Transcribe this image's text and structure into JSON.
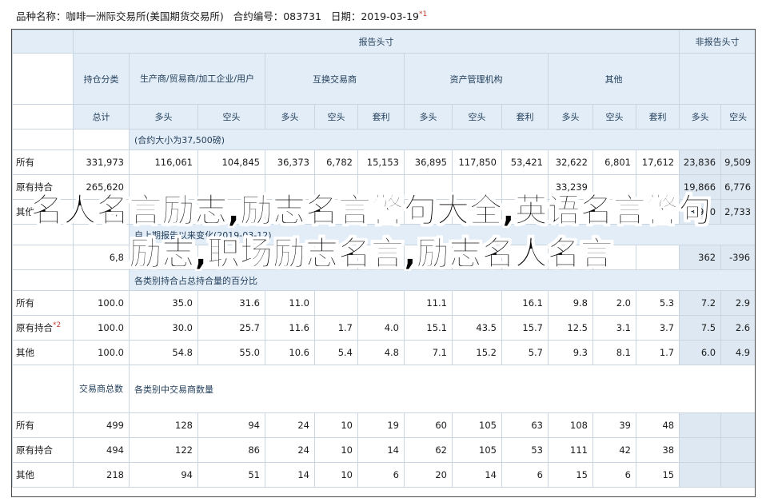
{
  "header": {
    "market": "品种名称：咖啡一洲际交易所(美国期货交易所)",
    "code": "合约编号：083731",
    "date": "日期：2019-03-19",
    "date_note": "*1"
  },
  "table": {
    "group_reportable": "报告头寸",
    "group_nonreportable": "非报告头寸",
    "col_category": "持仓分类",
    "col_producer": "生产商/贸易商/加工企业/用户",
    "col_swap": "互换交易商",
    "col_money": "资产管理机构",
    "col_other": "其他",
    "col_total": "总计",
    "long": "多头",
    "short": "空头",
    "spread": "套利",
    "section1": "(合约大小为37,500磅)",
    "section2_prefix": "自上期报告以来变化",
    "section2_date": "(2019-03-12)",
    "section3": "各类别持合占总持合量的百分比",
    "section4": "各类别中交易商数量",
    "col_traders_total": "交易商总数",
    "rows_positions": [
      {
        "label": "所有",
        "values": [
          "331,973",
          "116,061",
          "104,845",
          "36,373",
          "6,782",
          "15,153",
          "36,895",
          "117,850",
          "53,421",
          "32,622",
          "6,801",
          "17,612",
          "23,836",
          "9,509"
        ]
      },
      {
        "label": "原有持合",
        "values": [
          "265,620",
          "",
          "",
          "",
          "",
          "",
          "",
          "",
          "",
          "33,239",
          "",
          "",
          "19,866",
          "6,776"
        ]
      },
      {
        "label": "其他",
        "values": [
          "66,3",
          "",
          "",
          "",
          "",
          "",
          "",
          "",
          "",
          "",
          "",
          "1,13",
          "3,970",
          "2,733"
        ]
      }
    ],
    "rows_changes": [
      {
        "label": "",
        "values": [
          "6,8",
          "",
          "",
          "",
          "",
          "",
          "",
          "",
          "",
          "",
          "",
          "",
          "362",
          "-396"
        ]
      }
    ],
    "rows_percent": [
      {
        "label": "所有",
        "note": "",
        "values": [
          "100.0",
          "35.0",
          "31.6",
          "11.0",
          "",
          "",
          "11.1",
          "",
          "16.1",
          "9.8",
          "2.0",
          "5.3",
          "7.2",
          "2.9"
        ]
      },
      {
        "label": "原有持合",
        "note": "*2",
        "values": [
          "100.0",
          "30.0",
          "25.7",
          "11.6",
          "1.7",
          "4.0",
          "15.1",
          "43.5",
          "15.7",
          "12.5",
          "3.1",
          "3.7",
          "7.5",
          "2.6"
        ]
      },
      {
        "label": "其他",
        "note": "",
        "values": [
          "100.0",
          "54.8",
          "55.0",
          "10.6",
          "5.4",
          "4.8",
          "7.1",
          "15.2",
          "5.7",
          "9.3",
          "8.1",
          "1.7",
          "6.0",
          "4.9"
        ]
      }
    ],
    "rows_traders": [
      {
        "label": "所有",
        "values": [
          "499",
          "128",
          "94",
          "24",
          "10",
          "19",
          "60",
          "105",
          "63",
          "108",
          "39",
          "48",
          "",
          ""
        ]
      },
      {
        "label": "原有持合",
        "values": [
          "494",
          "122",
          "86",
          "24",
          "10",
          "14",
          "62",
          "105",
          "53",
          "111",
          "42",
          "38",
          "",
          ""
        ]
      },
      {
        "label": "其他",
        "values": [
          "218",
          "94",
          "51",
          "14",
          "10",
          "6",
          "20",
          "14",
          "6",
          "15",
          "6",
          "15",
          "",
          ""
        ]
      }
    ]
  },
  "overlay": {
    "title": "名人名言励志,励志名言警句大全,英语名言警句 励志,职场励志名言,励志名人名言"
  }
}
